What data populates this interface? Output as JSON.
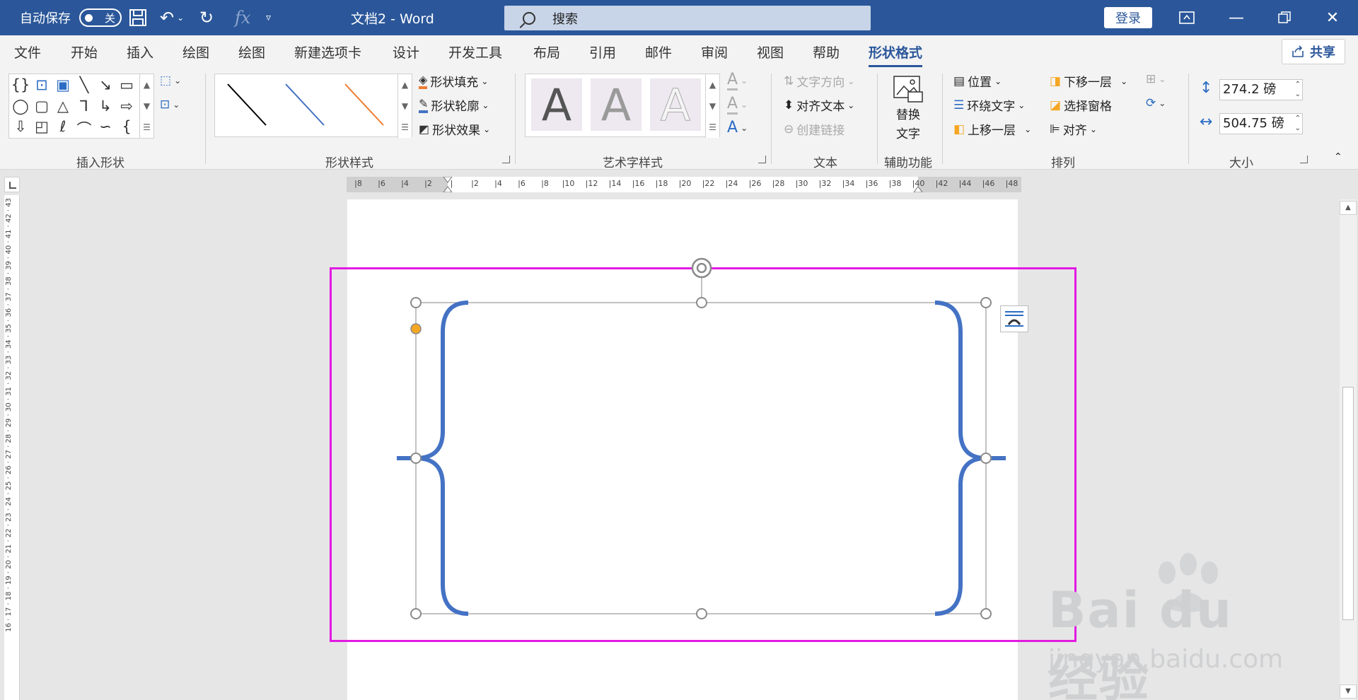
{
  "titlebar": {
    "autosave_label": "自动保存",
    "autosave_state": "关",
    "doc_title": "文档2  -  Word",
    "search_placeholder": "搜索",
    "login_label": "登录",
    "qat_icons": [
      "save-icon",
      "undo-icon",
      "redo-icon",
      "fx-icon",
      "customize-icon"
    ],
    "window_icons": [
      "ribbon-display-icon",
      "minimize-icon",
      "restore-icon",
      "close-icon"
    ]
  },
  "tabs": [
    "文件",
    "开始",
    "插入",
    "绘图",
    "绘图",
    "新建选项卡",
    "设计",
    "开发工具",
    "布局",
    "引用",
    "邮件",
    "审阅",
    "视图",
    "帮助",
    "形状格式"
  ],
  "active_tab": "形状格式",
  "share_label": "共享",
  "ribbon": {
    "groups": {
      "insert_shapes": "插入形状",
      "shape_styles": "形状样式",
      "wordart_styles": "艺术字样式",
      "text": "文本",
      "accessibility": "辅助功能",
      "arrange": "排列",
      "size": "大小"
    },
    "shape_fill": "形状填充",
    "shape_outline": "形状轮廓",
    "shape_effects": "形状效果",
    "text_direction": "文字方向",
    "align_text": "对齐文本",
    "create_link": "创建链接",
    "alt_text_line1": "替换",
    "alt_text_line2": "文字",
    "position": "位置",
    "wrap_text": "环绕文字",
    "bring_forward": "上移一层",
    "send_backward": "下移一层",
    "selection_pane": "选择窗格",
    "align": "对齐",
    "height_value": "274.2 磅",
    "width_value": "504.75 磅",
    "wordart_letter": "A"
  },
  "hruler_numbers": [
    "8",
    "6",
    "4",
    "2",
    "",
    "2",
    "4",
    "6",
    "8",
    "10",
    "12",
    "14",
    "16",
    "18",
    "20",
    "22",
    "24",
    "26",
    "28",
    "30",
    "32",
    "34",
    "36",
    "38",
    "40",
    "42",
    "44",
    "46",
    "48"
  ],
  "vruler_numbers": "16 · 17 · 18 · 19 · 20 · 21 · 22 · 23 · 24 · 25 · 26 · 27 · 28 · 29 · 30 · 31 · 32 · 33 · 34 · 35 · 36 · 37 · 38 · 39 · 40 · 41 · 42 · 43",
  "watermark": {
    "main": "Bai du 经验",
    "sub": "jingyan.baidu.com"
  },
  "colors": {
    "title_bar": "#2b579a",
    "brace": "#4472c4",
    "selection_outline": "#e21ae2",
    "adjust_handle": "#f5a623"
  }
}
